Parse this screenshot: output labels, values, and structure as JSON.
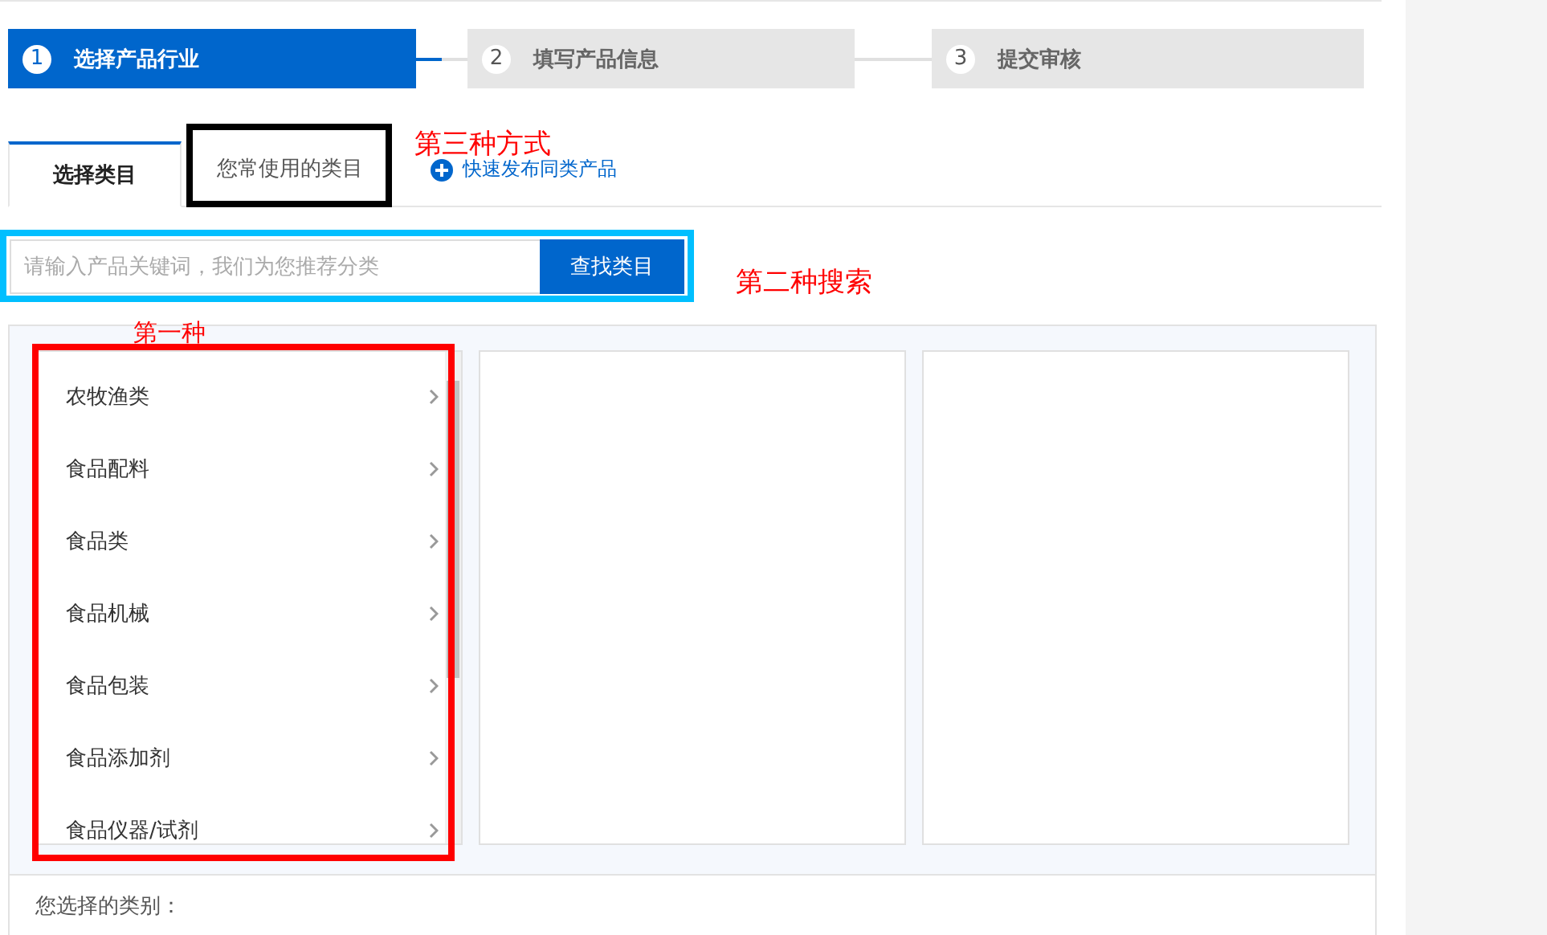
{
  "steps": [
    {
      "number": "1",
      "label": "选择产品行业",
      "selected": true
    },
    {
      "number": "2",
      "label": "填写产品信息",
      "selected": false
    },
    {
      "number": "3",
      "label": "提交审核",
      "selected": false
    }
  ],
  "tabs": [
    {
      "label": "选择类目",
      "selected": true
    },
    {
      "label": "您常使用的类目",
      "selected": false
    }
  ],
  "quick_link": "快速发布同类产品",
  "search": {
    "placeholder": "请输入产品关键词，我们为您推荐分类",
    "button": "查找类目"
  },
  "categories": [
    {
      "label": "农牧渔类"
    },
    {
      "label": "食品配料"
    },
    {
      "label": "食品类"
    },
    {
      "label": "食品机械"
    },
    {
      "label": "食品包装"
    },
    {
      "label": "食品添加剂"
    },
    {
      "label": "食品仪器/试剂"
    }
  ],
  "selected_label": "您选择的类别：",
  "annotations": [
    {
      "text": "第三种方式",
      "color": "#000000"
    },
    {
      "text": "第二种搜索",
      "color": "#00bfff"
    },
    {
      "text": "第一种",
      "color": "#ff0000"
    }
  ]
}
